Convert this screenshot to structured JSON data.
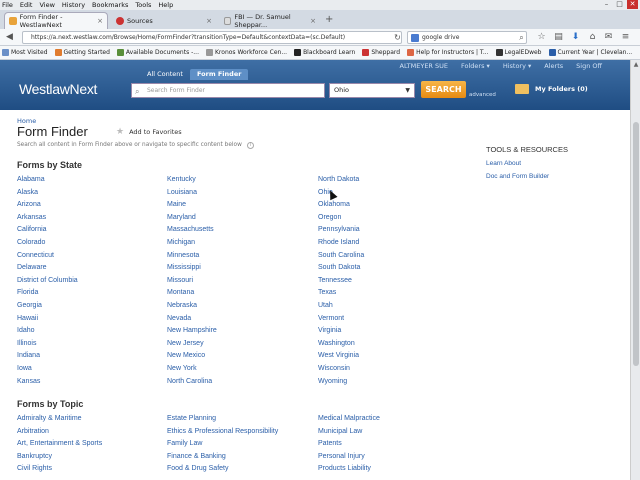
{
  "browser": {
    "menu": [
      "File",
      "Edit",
      "View",
      "History",
      "Bookmarks",
      "Tools",
      "Help"
    ],
    "tabs": [
      {
        "title": "Form Finder - WestlawNext",
        "active": true,
        "color": "#e8a33b"
      },
      {
        "title": "Sources",
        "active": false,
        "color": "#c33"
      },
      {
        "title": "FBI — Dr. Samuel Sheppar...",
        "active": false,
        "color": "#888"
      }
    ],
    "url": "https://a.next.westlaw.com/Browse/Home/FormFinder?transitionType=Default&contextData=(sc.Default)",
    "search_value": "google drive",
    "bookmarks": [
      {
        "label": "Most Visited",
        "color": "#6a8fc7"
      },
      {
        "label": "Getting Started",
        "color": "#e07b2e"
      },
      {
        "label": "Available Documents -...",
        "color": "#5a8f3a"
      },
      {
        "label": "Kronos Workforce Cen...",
        "color": "#999"
      },
      {
        "label": "Blackboard Learn",
        "color": "#222"
      },
      {
        "label": "Sheppard",
        "color": "#c33"
      },
      {
        "label": "Help for Instructors | T...",
        "color": "#d64"
      },
      {
        "label": "LegalEDweb",
        "color": "#333"
      },
      {
        "label": "Current Year | Clevelan...",
        "color": "#2a5ea8"
      }
    ]
  },
  "westlaw": {
    "nav_tabs": [
      "All Content",
      "Form Finder"
    ],
    "top_links": [
      "ALTMEYER SUE",
      "Folders ▾",
      "History ▾",
      "Alerts",
      "Sign Off"
    ],
    "logo": "WestlawNext",
    "search_placeholder": "Search Form Finder",
    "jurisdiction": "Ohio",
    "search_button": "SEARCH",
    "advanced": "advanced",
    "my_folders": "My Folders (0)"
  },
  "page": {
    "breadcrumb": "Home",
    "title": "Form Finder",
    "add_favorites": "Add to Favorites",
    "subtitle": "Search all content in Form Finder above or navigate to specific content below",
    "forms_by_state_heading": "Forms by State",
    "forms_by_topic_heading": "Forms by Topic",
    "states_col1": [
      "Alabama",
      "Alaska",
      "Arizona",
      "Arkansas",
      "California",
      "Colorado",
      "Connecticut",
      "Delaware",
      "District of Columbia",
      "Florida",
      "Georgia",
      "Hawaii",
      "Idaho",
      "Illinois",
      "Indiana",
      "Iowa",
      "Kansas"
    ],
    "states_col2": [
      "Kentucky",
      "Louisiana",
      "Maine",
      "Maryland",
      "Massachusetts",
      "Michigan",
      "Minnesota",
      "Mississippi",
      "Missouri",
      "Montana",
      "Nebraska",
      "Nevada",
      "New Hampshire",
      "New Jersey",
      "New Mexico",
      "New York",
      "North Carolina"
    ],
    "states_col3": [
      "North Dakota",
      "Ohio",
      "Oklahoma",
      "Oregon",
      "Pennsylvania",
      "Rhode Island",
      "South Carolina",
      "South Dakota",
      "Tennessee",
      "Texas",
      "Utah",
      "Vermont",
      "Virginia",
      "Washington",
      "West Virginia",
      "Wisconsin",
      "Wyoming"
    ],
    "topics_col1": [
      "Admiralty & Maritime",
      "Arbitration",
      "Art, Entertainment & Sports",
      "Bankruptcy",
      "Civil Rights"
    ],
    "topics_col2": [
      "Estate Planning",
      "Ethics & Professional Responsibility",
      "Family Law",
      "Finance & Banking",
      "Food & Drug Safety"
    ],
    "topics_col3": [
      "Medical Malpractice",
      "Municipal Law",
      "Patents",
      "Personal Injury",
      "Products Liability"
    ],
    "tools_heading": "TOOLS & RESOURCES",
    "tools_links": [
      "Learn About",
      "Doc and Form Builder"
    ]
  }
}
